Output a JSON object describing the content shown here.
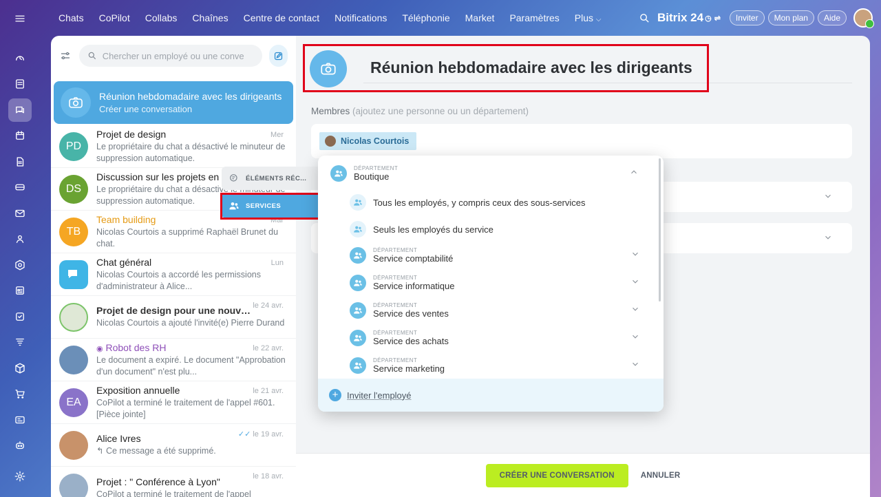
{
  "topnav": {
    "items": [
      "Chats",
      "CoPilot",
      "Collabs",
      "Chaînes",
      "Centre de contact",
      "Notifications",
      "Téléphonie",
      "Market",
      "Paramètres",
      "Plus"
    ],
    "brand": "Bitrix 24",
    "invite": "Inviter",
    "plan": "Mon plan",
    "help": "Aide"
  },
  "sidebar_icons": [
    "menu-icon",
    "activity-icon",
    "feed-icon",
    "chat-icon",
    "calendar-icon",
    "documents-icon",
    "drive-icon",
    "mail-icon",
    "contacts-icon",
    "automation-icon",
    "crm-icon",
    "tasks-icon",
    "funnel-icon",
    "package-icon",
    "cart-icon",
    "site-icon",
    "robot-icon",
    "settings-icon"
  ],
  "chatlist": {
    "search_placeholder": "Chercher un employé ou une conve",
    "selected": {
      "title": "Réunion hebdomadaire avec les dirigeants",
      "subtitle": "Créer une conversation"
    },
    "items": [
      {
        "initials": "PD",
        "color": "#48b4a8",
        "name": "Projet de design",
        "date": "Mer",
        "msg": "Le propriétaire du chat a désactivé le minuteur de suppression automatique."
      },
      {
        "initials": "DS",
        "color": "#6aa332",
        "name": "Discussion sur les projets en cours",
        "date": "",
        "msg": "Le propriétaire du chat a désactivé le minuteur de suppression automatique."
      },
      {
        "initials": "TB",
        "color": "#f5a623",
        "name": "Team building",
        "date": "Mar",
        "msg": "Nicolas Courtois a supprimé Raphaël Brunet du chat."
      },
      {
        "initials": "",
        "color": "#3fb5e6",
        "name": "Chat général",
        "date": "Lun",
        "msg": "Nicolas Courtois a accordé les permissions d'administrateur à Alice..."
      },
      {
        "initials": "",
        "color": "#b9d4a0",
        "name": "Projet de design pour une nouvel...",
        "date": "le 24 avr.",
        "msg": "Nicolas Courtois a ajouté l'invité(e) Pierre Durand"
      },
      {
        "initials": "",
        "color": "#6b8fb8",
        "name": "Robot des RH",
        "date": "le 22 avr.",
        "msg": "Le document a expiré. Le document \"Approbation d'un document\" n'est plu..."
      },
      {
        "initials": "EA",
        "color": "#8a73c9",
        "name": "Exposition annuelle",
        "date": "le 21 avr.",
        "msg": "CoPilot a terminé le traitement de l'appel #601. [Pièce jointe]"
      },
      {
        "initials": "",
        "color": "#c8926a",
        "name": "Alice Ivres",
        "date": "le 19 avr.",
        "msg": "↰ Ce message a été supprimé."
      },
      {
        "initials": "",
        "color": "#9ab0c8",
        "name": "Projet : \" Conférence à Lyon\"",
        "date": "le 18 avr.",
        "msg": "CoPilot a terminé le traitement de l'appel"
      }
    ]
  },
  "main": {
    "title": "Réunion hebdomadaire avec les dirigeants",
    "members_label": "Membres",
    "members_hint": "(ajoutez une personne ou un département)",
    "member_chip": "Nicolas Courtois",
    "create_btn": "CRÉER UNE CONVERSATION",
    "cancel_btn": "ANNULER"
  },
  "sidetabs": {
    "recent": "ÉLÉMENTS RÉC...",
    "services": "SERVICES"
  },
  "popup": {
    "dept_tag": "DÉPARTEMENT",
    "root": "Boutique",
    "all_employees": "Tous les employés, y compris ceux des sous-services",
    "only_service": "Seuls les employés du service",
    "departments": [
      "Service comptabilité",
      "Service informatique",
      "Service des ventes",
      "Service des achats",
      "Service marketing"
    ],
    "invite": "Inviter l'employé"
  }
}
